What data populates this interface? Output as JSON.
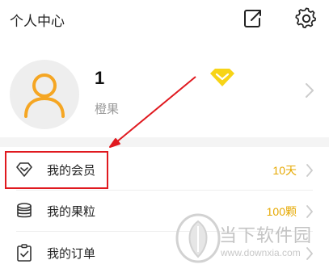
{
  "header": {
    "title": "个人中心",
    "share_icon": "share-icon",
    "settings_icon": "gear-icon"
  },
  "profile": {
    "name": "1",
    "subtitle": "橙果",
    "avatar_icon": "person-avatar-icon",
    "badge_icon": "vip-diamond-icon",
    "accent_color": "#f5a623"
  },
  "menu": {
    "items": [
      {
        "label": "我的会员",
        "value": "10天",
        "icon": "diamond-outline-icon"
      },
      {
        "label": "我的果粒",
        "value": "100颗",
        "icon": "coins-icon"
      },
      {
        "label": "我的订单",
        "value": "",
        "icon": "clipboard-icon"
      }
    ],
    "value_color": "#e6a800"
  },
  "annotation": {
    "color": "#e0191f"
  },
  "watermark": {
    "title": "当下软件园",
    "url": "www.downxia.com"
  }
}
